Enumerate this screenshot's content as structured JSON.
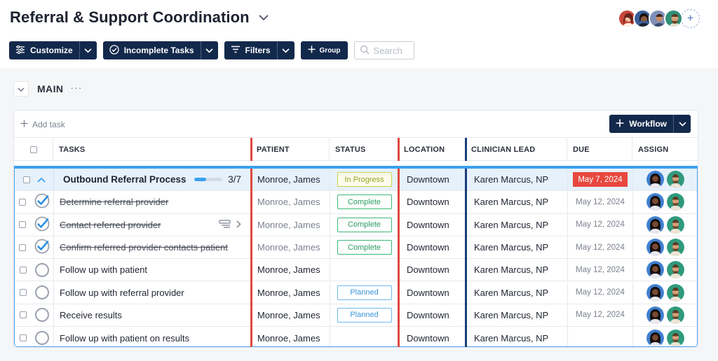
{
  "header": {
    "title": "Referral & Support Coordination",
    "add_member_label": "+"
  },
  "toolbar": {
    "customize_label": "Customize",
    "incomplete_label": "Incomplete Tasks",
    "filters_label": "Filters",
    "group_label": "Group",
    "search_placeholder": "Search"
  },
  "section": {
    "name": "MAIN",
    "more_label": "···"
  },
  "table": {
    "add_task_label": "Add task",
    "workflow_label": "Workflow",
    "columns": {
      "tasks": "TASKS",
      "patient": "PATIENT",
      "status": "STATUS",
      "location": "LOCATION",
      "clinician": "CLINICIAN LEAD",
      "due": "DUE",
      "assign": "ASSIGN"
    },
    "parent": {
      "task": "Outbound Referral Process",
      "progress_text": "3/7",
      "progress_fraction": 0.43,
      "patient": "Monroe, James",
      "status": "In Progress",
      "location": "Downtown",
      "clinician": "Karen Marcus, NP",
      "due": "May 7, 2024"
    },
    "rows": [
      {
        "task": "Determine referral provider",
        "done": true,
        "patient": "Monroe, James",
        "status": "Complete",
        "location": "Downtown",
        "clinician": "Karen Marcus, NP",
        "due": "May 12, 2024"
      },
      {
        "task": "Contact referred provider",
        "done": true,
        "patient": "Monroe, James",
        "status": "Complete",
        "location": "Downtown",
        "clinician": "Karen Marcus, NP",
        "due": "May 12, 2024"
      },
      {
        "task": "Confirm referred provider contacts patient",
        "done": true,
        "patient": "Monroe, James",
        "status": "Complete",
        "location": "Downtown",
        "clinician": "Karen Marcus, NP",
        "due": "May 12, 2024"
      },
      {
        "task": "Follow up with patient",
        "done": false,
        "patient": "Monroe, James",
        "status": "",
        "location": "Downtown",
        "clinician": "Karen Marcus, NP",
        "due": "May 12, 2024"
      },
      {
        "task": "Follow up with referral provider",
        "done": false,
        "patient": "Monroe, James",
        "status": "Planned",
        "location": "Downtown",
        "clinician": "Karen Marcus, NP",
        "due": "May 12, 2024"
      },
      {
        "task": "Receive results",
        "done": false,
        "patient": "Monroe, James",
        "status": "Planned",
        "location": "Downtown",
        "clinician": "Karen Marcus, NP",
        "due": "May 12, 2024"
      },
      {
        "task": "Follow up with patient on results",
        "done": false,
        "patient": "Monroe, James",
        "status": "",
        "location": "Downtown",
        "clinician": "Karen Marcus, NP",
        "due": ""
      }
    ]
  },
  "colors": {
    "navy": "#13294b",
    "accent_blue": "#3aa0f0",
    "red_marker": "#e0483e",
    "overdue_red": "#e8483f",
    "complete_green": "#3cb878",
    "in_progress_yellow": "#c9d24a"
  }
}
